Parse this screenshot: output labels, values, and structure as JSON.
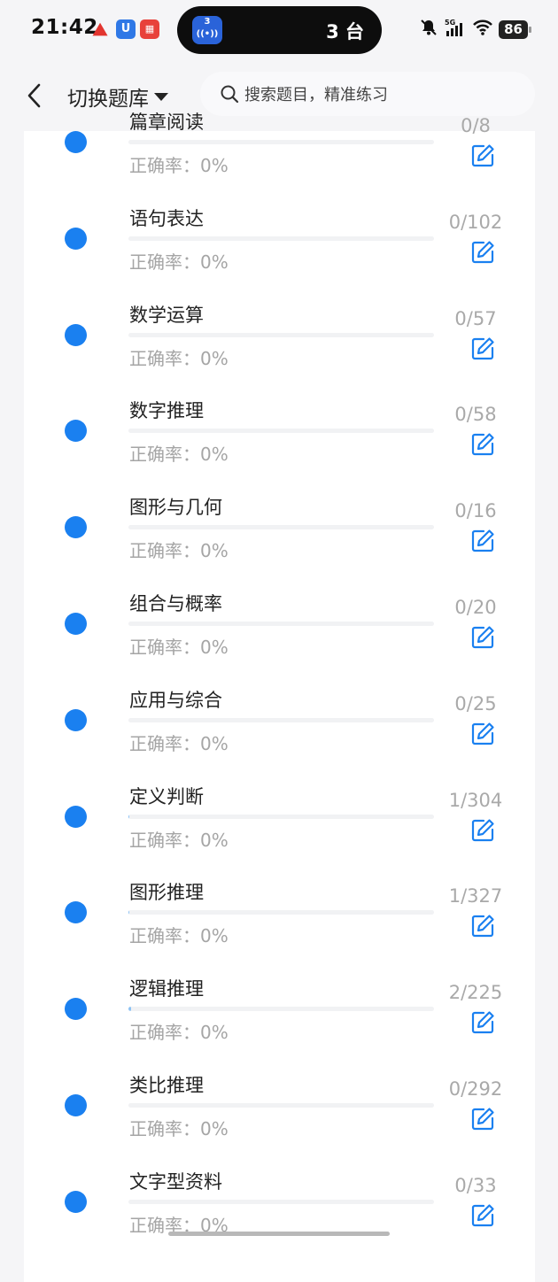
{
  "status_bar": {
    "time": "21:42",
    "notification_icons": [
      "app-red-icon",
      "app-blue-u-icon",
      "app-red-square-icon"
    ],
    "live_activity": {
      "icon_badge": "3",
      "text": "3 台"
    },
    "battery": "86",
    "network": "5G"
  },
  "header": {
    "switch_label": "切换题库",
    "search_placeholder": "搜索题目，精准练习"
  },
  "items": [
    {
      "title": "篇章阅读",
      "accuracy": "正确率：0%",
      "count": "0/8",
      "progress": 0
    },
    {
      "title": "语句表达",
      "accuracy": "正确率：0%",
      "count": "0/102",
      "progress": 0
    },
    {
      "title": "数学运算",
      "accuracy": "正确率：0%",
      "count": "0/57",
      "progress": 0
    },
    {
      "title": "数字推理",
      "accuracy": "正确率：0%",
      "count": "0/58",
      "progress": 0
    },
    {
      "title": "图形与几何",
      "accuracy": "正确率：0%",
      "count": "0/16",
      "progress": 0
    },
    {
      "title": "组合与概率",
      "accuracy": "正确率：0%",
      "count": "0/20",
      "progress": 0
    },
    {
      "title": "应用与综合",
      "accuracy": "正确率：0%",
      "count": "0/25",
      "progress": 0
    },
    {
      "title": "定义判断",
      "accuracy": "正确率：0%",
      "count": "1/304",
      "progress": 0.003
    },
    {
      "title": "图形推理",
      "accuracy": "正确率：0%",
      "count": "1/327",
      "progress": 0.003
    },
    {
      "title": "逻辑推理",
      "accuracy": "正确率：0%",
      "count": "2/225",
      "progress": 0.009
    },
    {
      "title": "类比推理",
      "accuracy": "正确率：0%",
      "count": "0/292",
      "progress": 0
    },
    {
      "title": "文字型资料",
      "accuracy": "正确率：0%",
      "count": "0/33",
      "progress": 0
    }
  ],
  "colors": {
    "accent": "#1a80f0",
    "edit_icon": "#1a80f0",
    "muted_text": "#a5a5a5"
  }
}
